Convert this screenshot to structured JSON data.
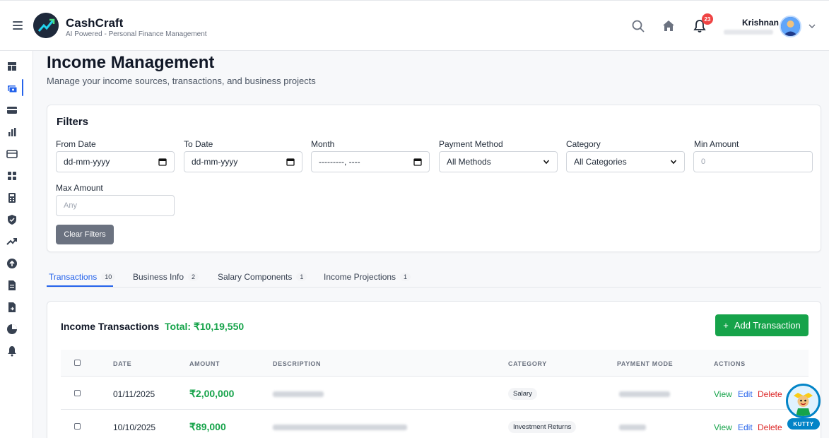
{
  "brand": {
    "name": "CashCraft",
    "tagline": "AI Powered - Personal Finance Management"
  },
  "header": {
    "notification_count": "23",
    "user_name": "Krishnan"
  },
  "page": {
    "title": "Income Management",
    "subtitle": "Manage your income sources, transactions, and business projects"
  },
  "filters": {
    "title": "Filters",
    "from_date": {
      "label": "From Date",
      "value": "dd-mm-yyyy"
    },
    "to_date": {
      "label": "To Date",
      "value": "dd-mm-yyyy"
    },
    "month": {
      "label": "Month",
      "value": "---------, ----"
    },
    "payment_method": {
      "label": "Payment Method",
      "value": "All Methods"
    },
    "category": {
      "label": "Category",
      "value": "All Categories"
    },
    "min_amount": {
      "label": "Min Amount",
      "placeholder": "0"
    },
    "max_amount": {
      "label": "Max Amount",
      "placeholder": "Any"
    },
    "clear_label": "Clear Filters"
  },
  "tabs": [
    {
      "label": "Transactions",
      "count": "10"
    },
    {
      "label": "Business Info",
      "count": "2"
    },
    {
      "label": "Salary Components",
      "count": "1"
    },
    {
      "label": "Income Projections",
      "count": "1"
    }
  ],
  "transactions": {
    "title": "Income Transactions",
    "total": "Total: ₹10,19,550",
    "add_label": "Add Transaction",
    "columns": [
      "DATE",
      "AMOUNT",
      "DESCRIPTION",
      "CATEGORY",
      "PAYMENT MODE",
      "ACTIONS"
    ],
    "rows": [
      {
        "date": "01/11/2025",
        "amount": "₹2,00,000",
        "category": "Salary"
      },
      {
        "date": "10/10/2025",
        "amount": "₹89,000",
        "category": "Investment Returns"
      }
    ],
    "actions": {
      "view": "View",
      "edit": "Edit",
      "delete": "Delete"
    }
  },
  "assistant": {
    "label": "KUTTY"
  },
  "colors": {
    "accent": "#2563eb",
    "success": "#16a34a",
    "danger": "#dc2626",
    "badge": "#ef4444"
  }
}
